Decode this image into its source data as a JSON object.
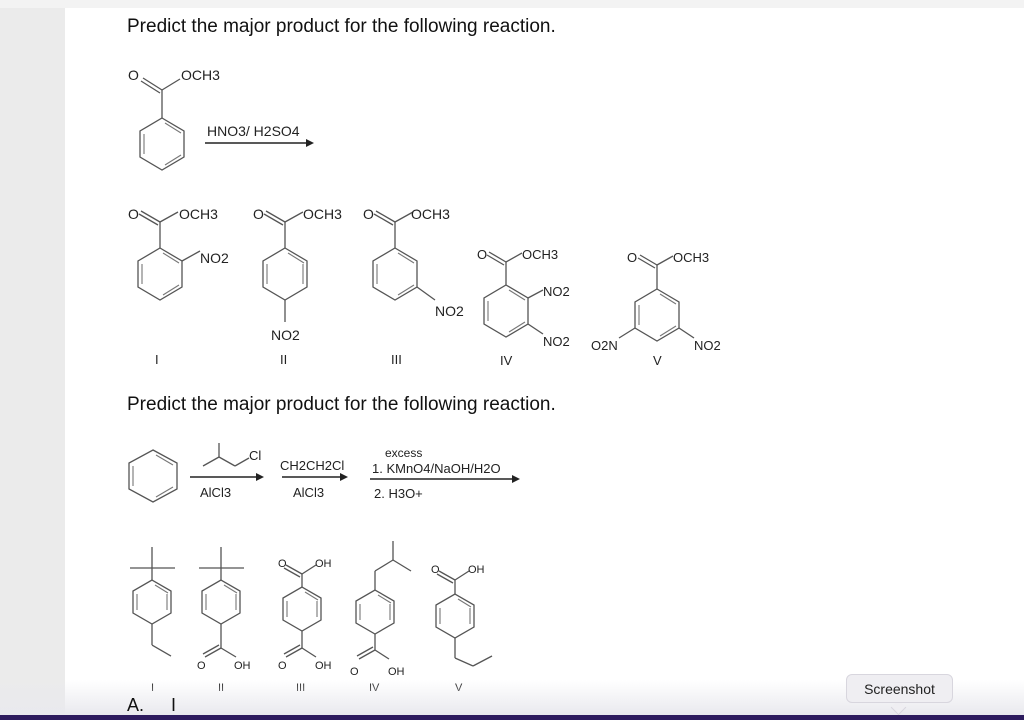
{
  "question1": {
    "heading": "Predict the major product for the following reaction.",
    "starting_material": {
      "carbonyl_O": "O",
      "ester_group": "OCH3"
    },
    "reagent": "HNO3/ H2SO4",
    "options": [
      {
        "label": "I",
        "substituents": [
          "OCH3",
          "NO2"
        ]
      },
      {
        "label": "II",
        "substituents": [
          "OCH3",
          "NO2"
        ]
      },
      {
        "label": "III",
        "substituents": [
          "OCH3",
          "NO2"
        ]
      },
      {
        "label": "IV",
        "substituents": [
          "OCH3",
          "NO2",
          "NO2"
        ]
      },
      {
        "label": "V",
        "substituents": [
          "OCH3",
          "O2N",
          "NO2"
        ]
      }
    ]
  },
  "question2": {
    "heading": "Predict the major product for the following reaction.",
    "step1": {
      "above": "Cl",
      "below": "AlCl3"
    },
    "step2": {
      "above": "CH2CH2Cl",
      "below": "AlCl3"
    },
    "step3": {
      "line0": "excess",
      "line1": "1. KMnO4/NaOH/H2O",
      "line2": "2. H3O+"
    },
    "options": [
      {
        "label": "I"
      },
      {
        "label": "II",
        "groups": [
          "O",
          "OH"
        ]
      },
      {
        "label": "III",
        "groups": [
          "O",
          "OH",
          "O",
          "OH"
        ]
      },
      {
        "label": "IV",
        "groups": [
          "O",
          "OH"
        ]
      },
      {
        "label": "V",
        "groups": [
          "O",
          "OH"
        ]
      }
    ]
  },
  "answer": {
    "prefix": "A.",
    "value": "I"
  },
  "tooltip": {
    "label": "Screenshot"
  }
}
